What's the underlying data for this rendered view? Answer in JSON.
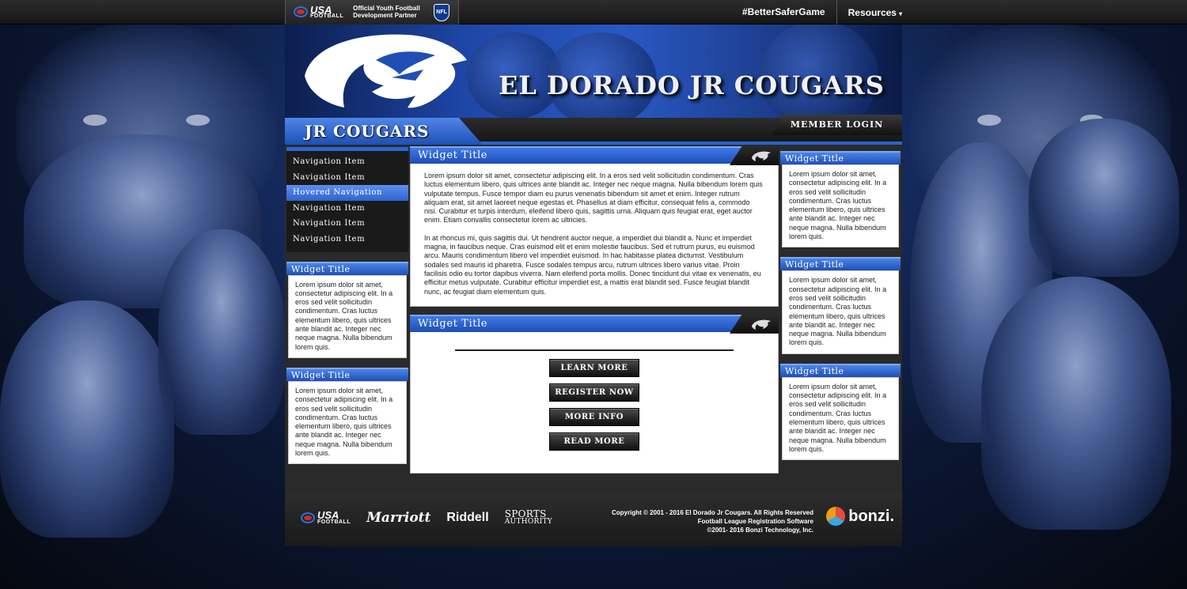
{
  "topbar": {
    "usa_logo_big": "USA",
    "usa_logo_small": "FOOTBALL",
    "partner_line1": "Official Youth Football",
    "partner_line2": "Development Partner",
    "nfl_label": "NFL",
    "hashtag": "#BetterSaferGame",
    "resources": "Resources"
  },
  "header": {
    "site_title": "EL DORADO JR COUGARS",
    "tab_label": "JR COUGARS",
    "member_login": "MEMBER LOGIN"
  },
  "nav": {
    "items": [
      {
        "label": "Navigation Item"
      },
      {
        "label": "Navigation Item"
      },
      {
        "label": "Hovered Navigation"
      },
      {
        "label": "Navigation Item"
      },
      {
        "label": "Navigation Item"
      },
      {
        "label": "Navigation Item"
      }
    ]
  },
  "left_widgets": [
    {
      "title": "Widget Title",
      "body": "Lorem ipsum dolor sit amet, consectetur adipiscing elit. In a eros sed velit sollicitudin condimentum. Cras luctus elementum libero, quis ultrices ante blandit ac. Integer nec neque magna. Nulla bibendum lorem quis."
    },
    {
      "title": "Widget Title",
      "body": "Lorem ipsum dolor sit amet, consectetur adipiscing elit. In a eros sed velit sollicitudin condimentum. Cras luctus elementum libero, quis ultrices ante blandit ac. Integer nec neque magna. Nulla bibendum lorem quis."
    }
  ],
  "main_widget": {
    "title": "Widget Title",
    "paragraph1": "Lorem ipsum dolor sit amet, consectetur adipiscing elit. In a eros sed velit sollicitudin condimentum. Cras luctus elementum libero, quis ultrices ante blandit ac. Integer nec neque magna. Nulla bibendum lorem quis vulputate tempus. Fusce tempor diam eu purus venenatis bibendum sit amet et enim. Integer rutrum aliquam erat, sit amet laoreet neque egestas et. Phasellus at diam efficitur, consequat felis a, commodo nisi. Curabitur et turpis interdum, eleifend libero quis, sagittis urna. Aliquam quis feugiat erat, eget auctor enim. Etiam convallis consectetur lorem ac ultricies.",
    "paragraph2": "In at rhoncus mi, quis sagittis dui. Ut hendrerit auctor neque, a imperdiet dui blandit a. Nunc et imperdiet magna, in faucibus neque. Cras euismod elit et enim molestie faucibus. Sed et rutrum purus, eu euismod arcu. Mauris condimentum libero vel imperdiet euismod. In hac habitasse platea dictumst. Vestibulum sodales sed mauris id pharetra. Fusce sodales tempus arcu, rutrum ultrices libero varius vitae. Proin facilisis odio eu tortor dapibus viverra. Nam eleifend porta mollis. Donec tincidunt dui vitae ex venenatis, eu efficitur metus vulputate. Curabitur efficitur imperdiet est, a mattis erat blandit sed. Fusce feugiat blandit nunc, ac feugiat diam elementum quis."
  },
  "buttons_widget": {
    "title": "Widget Title",
    "buttons": [
      "LEARN MORE",
      "REGISTER NOW",
      "MORE INFO",
      "READ MORE"
    ]
  },
  "right_widgets": [
    {
      "title": "Widget Title",
      "body": "Lorem ipsum dolor sit amet, consectetur adipiscing elit. In a eros sed velit sollicitudin condimentum. Cras luctus elementum libero, quis ultrices ante blandit ac. Integer nec neque magna. Nulla bibendum lorem quis."
    },
    {
      "title": "Widget Title",
      "body": "Lorem ipsum dolor sit amet, consectetur adipiscing elit. In a eros sed velit sollicitudin condimentum. Cras luctus elementum libero, quis ultrices ante blandit ac. Integer nec neque magna. Nulla bibendum lorem quis."
    },
    {
      "title": "Widget Title",
      "body": "Lorem ipsum dolor sit amet, consectetur adipiscing elit. In a eros sed velit sollicitudin condimentum. Cras luctus elementum libero, quis ultrices ante blandit ac. Integer nec neque magna. Nulla bibendum lorem quis."
    }
  ],
  "footer": {
    "sponsor_usa_big": "USA",
    "sponsor_usa_small": "FOOTBALL",
    "sponsor_marriott": "Marriott",
    "sponsor_riddell": "Riddell",
    "sponsor_sports_line1": "SPORTS",
    "sponsor_sports_line2": "AUTHORITY",
    "copyright_line1": "Copyright © 2001 - 2016 El Dorado Jr Cougars.  All Rights Reserved",
    "copyright_line2": "Football League Registration Software",
    "copyright_line3": "©2001- 2016 Bonzi Technology, Inc.",
    "bonzi": "bonzi."
  },
  "colors": {
    "brand_blue": "#2b65d3",
    "dark_panel": "#2a2a2a"
  }
}
